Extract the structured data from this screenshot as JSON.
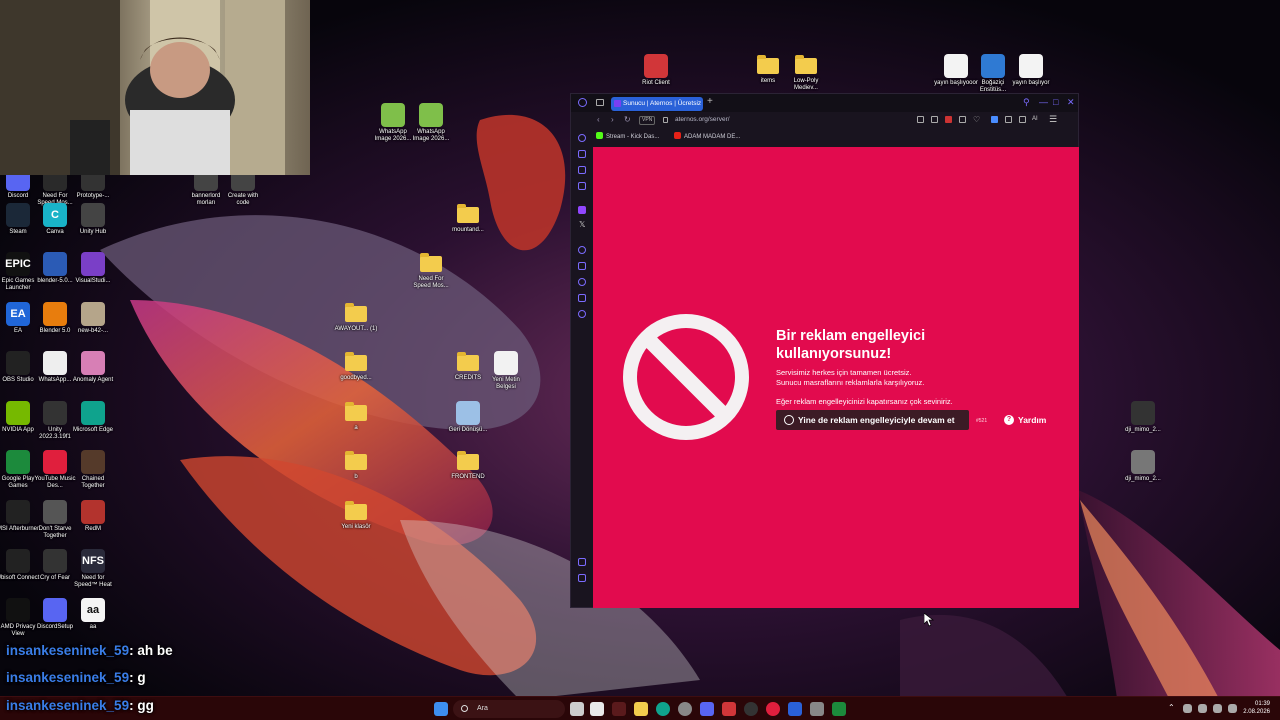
{
  "desktop": {
    "icons": [
      {
        "id": "discord-shortcut",
        "label": "Discord",
        "glyph": "",
        "color": "#5865f2"
      },
      {
        "id": "nfs-mw",
        "label": "Need For Speed Mos...",
        "glyph": "",
        "color": "#2a2a2a"
      },
      {
        "id": "prototype",
        "label": "Prototype-...",
        "glyph": "",
        "color": "#333"
      },
      {
        "id": "bannerlord",
        "label": "bannerlord morları",
        "glyph": "",
        "color": "#444"
      },
      {
        "id": "create-code",
        "label": "Create with code",
        "glyph": "",
        "color": "#444"
      },
      {
        "id": "steam",
        "label": "Steam",
        "glyph": "",
        "color": "#1b2838"
      },
      {
        "id": "canva",
        "label": "Canva",
        "glyph": "C",
        "color": "#19b3c8"
      },
      {
        "id": "unity-hub",
        "label": "Unity Hub",
        "glyph": "",
        "color": "#444"
      },
      {
        "id": "epic",
        "label": "Epic Games Launcher",
        "glyph": "EPIC",
        "color": "#111"
      },
      {
        "id": "blender5",
        "label": "blender-5.0...",
        "glyph": "",
        "color": "#2b5bb5"
      },
      {
        "id": "visualstudio",
        "label": "VisualStudi...",
        "glyph": "",
        "color": "#7a3fc7"
      },
      {
        "id": "ea",
        "label": "EA",
        "glyph": "EA",
        "color": "#2066d8"
      },
      {
        "id": "blender",
        "label": "Blender 5.0",
        "glyph": "",
        "color": "#e87d0d"
      },
      {
        "id": "newb42",
        "label": "new-b42-...",
        "glyph": "",
        "color": "#b5a58a"
      },
      {
        "id": "obs",
        "label": "OBS Studio",
        "glyph": "",
        "color": "#222"
      },
      {
        "id": "whatsapp-file",
        "label": "WhatsApp...",
        "glyph": "",
        "color": "#eee"
      },
      {
        "id": "anomaly-agent",
        "label": "Anomaly Agent",
        "glyph": "",
        "color": "#d77fb5"
      },
      {
        "id": "nvidia",
        "label": "NVIDIA App",
        "glyph": "",
        "color": "#76b900"
      },
      {
        "id": "unity2022",
        "label": "Unity 2022.3.19f1",
        "glyph": "",
        "color": "#333"
      },
      {
        "id": "edge",
        "label": "Microsoft Edge",
        "glyph": "",
        "color": "#0fa38d"
      },
      {
        "id": "google-play",
        "label": "Google Play Games",
        "glyph": "",
        "color": "#1c8a3c"
      },
      {
        "id": "ytmusic",
        "label": "YouTube Music Des...",
        "glyph": "",
        "color": "#e01f3d"
      },
      {
        "id": "chained",
        "label": "Chained Together",
        "glyph": "",
        "color": "#553a2a"
      },
      {
        "id": "msi",
        "label": "MSI Afterburner",
        "glyph": "",
        "color": "#222"
      },
      {
        "id": "dontstarve",
        "label": "Don't Starve Together",
        "glyph": "",
        "color": "#555"
      },
      {
        "id": "redm",
        "label": "RedM",
        "glyph": "",
        "color": "#b3332d"
      },
      {
        "id": "ubisoft",
        "label": "Ubisoft Connect",
        "glyph": "",
        "color": "#222"
      },
      {
        "id": "cryoffear",
        "label": "Cry of Fear",
        "glyph": "",
        "color": "#333"
      },
      {
        "id": "nfsheat",
        "label": "Need for Speed™ Heat",
        "glyph": "NFS",
        "color": "#2a2a3a"
      },
      {
        "id": "amd",
        "label": "AMD Privacy View",
        "glyph": "",
        "color": "#111"
      },
      {
        "id": "discordsetup",
        "label": "DiscordSetup",
        "glyph": "",
        "color": "#5865f2"
      },
      {
        "id": "aa",
        "label": "aa",
        "glyph": "aa",
        "color": "#f5f5f5"
      },
      {
        "id": "wa-img-1",
        "label": "WhatsApp Image 2026...",
        "glyph": "",
        "color": "#7fbf4a"
      },
      {
        "id": "wa-img-2",
        "label": "WhatsApp Image 2026...",
        "glyph": "",
        "color": "#7fbf4a"
      },
      {
        "id": "mountand",
        "label": "mountand...",
        "glyph": "",
        "color": "folder"
      },
      {
        "id": "nfs-folder",
        "label": "Need For Speed Mos...",
        "glyph": "",
        "color": "folder"
      },
      {
        "id": "awayout",
        "label": "AWAYOUT... (1)",
        "glyph": "",
        "color": "folder"
      },
      {
        "id": "goodbyed",
        "label": "goodbyed...",
        "glyph": "",
        "color": "folder"
      },
      {
        "id": "folder-a",
        "label": "a",
        "glyph": "",
        "color": "folder"
      },
      {
        "id": "folder-b",
        "label": "b",
        "glyph": "",
        "color": "folder"
      },
      {
        "id": "yeni-klasor",
        "label": "Yeni klasör",
        "glyph": "",
        "color": "folder"
      },
      {
        "id": "credits",
        "label": "CREDITS",
        "glyph": "",
        "color": "folder"
      },
      {
        "id": "yeni-metin",
        "label": "Yeni Metin Belgesi",
        "glyph": "",
        "color": "#f2f2f2"
      },
      {
        "id": "geri-donusum",
        "label": "Geri Dönüşü...",
        "glyph": "",
        "color": "#9cc0e6"
      },
      {
        "id": "frontend",
        "label": "FRONTEND",
        "glyph": "",
        "color": "folder"
      },
      {
        "id": "riot",
        "label": "Riot Client",
        "glyph": "",
        "color": "#d13639"
      },
      {
        "id": "items",
        "label": "items",
        "glyph": "",
        "color": "folder"
      },
      {
        "id": "lowpoly",
        "label": "Low-Poly Mediev...",
        "glyph": "",
        "color": "folder"
      },
      {
        "id": "yayin-1",
        "label": "yayın başlıyooor",
        "glyph": "",
        "color": "#f3f3f3"
      },
      {
        "id": "bogazici",
        "label": "Boğaziçi Enstitüs...",
        "glyph": "",
        "color": "#2f7ad3"
      },
      {
        "id": "yayin-2",
        "label": "yayın başlıyor",
        "glyph": "",
        "color": "#f3f3f3"
      },
      {
        "id": "dji-1",
        "label": "dji_mimo_2...",
        "glyph": "",
        "color": "#333"
      },
      {
        "id": "dji-2",
        "label": "dji_mimo_2...",
        "glyph": "",
        "color": "#777"
      }
    ]
  },
  "browser": {
    "tab_title": "Sunucu | Aternos | Ücretsiz",
    "new_tab_glyph": "+",
    "vpn_label": "VPN",
    "url": "aternos.org/server/",
    "ai_label": "AI",
    "bookmarks": [
      {
        "label": "Stream - Kick Das...",
        "color": "#53fc18"
      },
      {
        "label": "ADAM MADAM DE...",
        "color": "#e62117"
      }
    ]
  },
  "adblock": {
    "title": "Bir reklam engelleyici kullanıyorsunuz!",
    "line1": "Servisimiz herkes için tamamen ücretsiz.",
    "line2": "Sunucu masraflarını reklamlarla karşılıyoruz.",
    "line3": "Eğer reklam engelleyicinizi kapatırsanız çok seviniriz.",
    "continue_label": "Yine de reklam engelleyiciyle devam et",
    "ref_code": "#521",
    "help_label": "Yardım",
    "help_glyph": "?"
  },
  "chat": [
    {
      "user": "insankeseninek_59",
      "message": ": ah be"
    },
    {
      "user": "insankeseninek_59",
      "message": ": g"
    },
    {
      "user": "insankeseninek_59",
      "message": ": gg"
    }
  ],
  "taskbar": {
    "search_placeholder": "Ara",
    "time": "01:39",
    "date": "2.08.2026"
  },
  "colors": {
    "adblock_bg": "#e20b4e",
    "tab_active": "#2a61d8",
    "taskbar_bg": "#2a0608"
  }
}
